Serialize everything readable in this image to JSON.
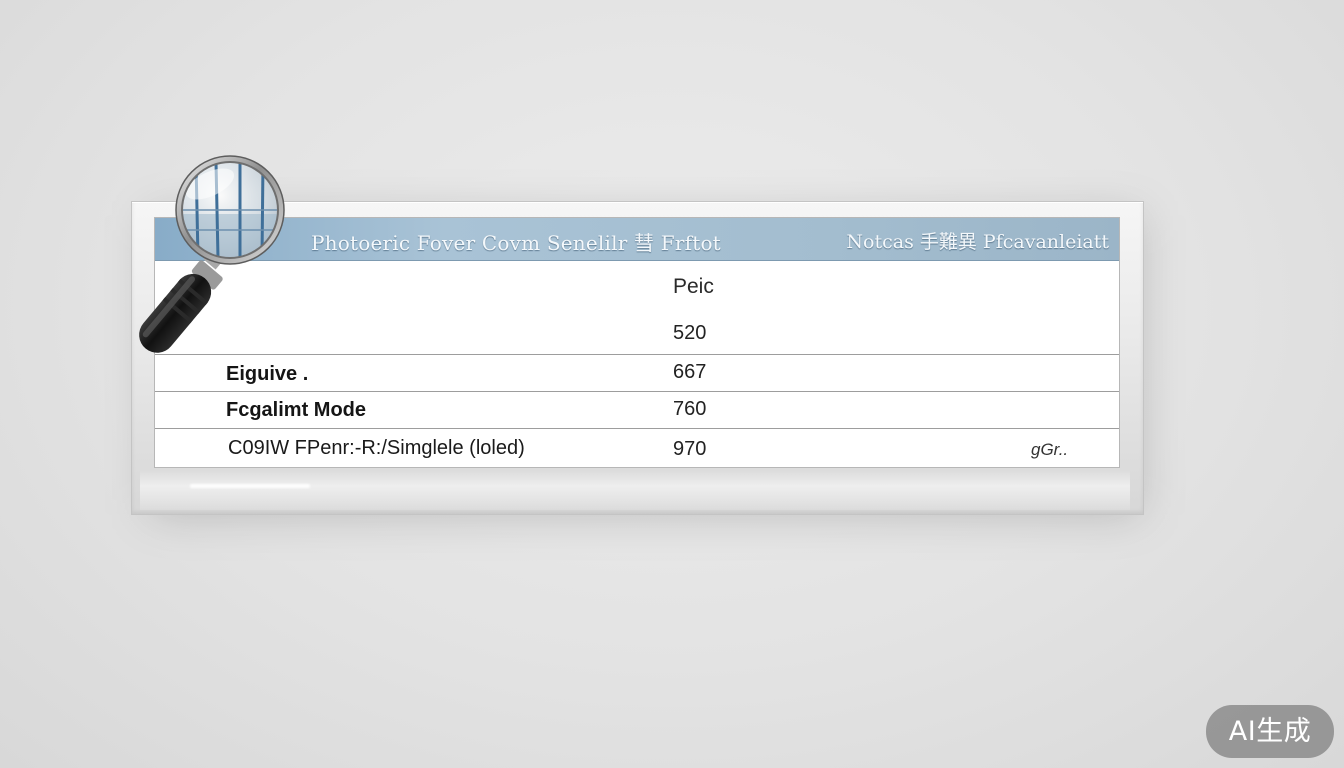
{
  "table": {
    "header_title": "Photoeric Fover Covm Senelilr 彗 Frftot",
    "header_right": "Notcas 手難異 Pfcavanleiatt",
    "column_header": "Peic",
    "rows": [
      {
        "label": "",
        "value": "520",
        "extra": ""
      },
      {
        "label": "Eiguive .",
        "value": "667",
        "extra": ""
      },
      {
        "label": "Fcgalimt Mode",
        "value": "760",
        "extra": ""
      },
      {
        "label": "C09IW FPenr:-R:/Simglele (loled)",
        "value": "970",
        "extra": "gGr.."
      }
    ]
  },
  "icons": {
    "magnifier": "magnifying-glass-icon"
  },
  "colors": {
    "header_start": "#88acc8",
    "header_end": "#9bb5c8",
    "background": "#e3e3e3"
  },
  "badge": {
    "label": "AI生成"
  }
}
